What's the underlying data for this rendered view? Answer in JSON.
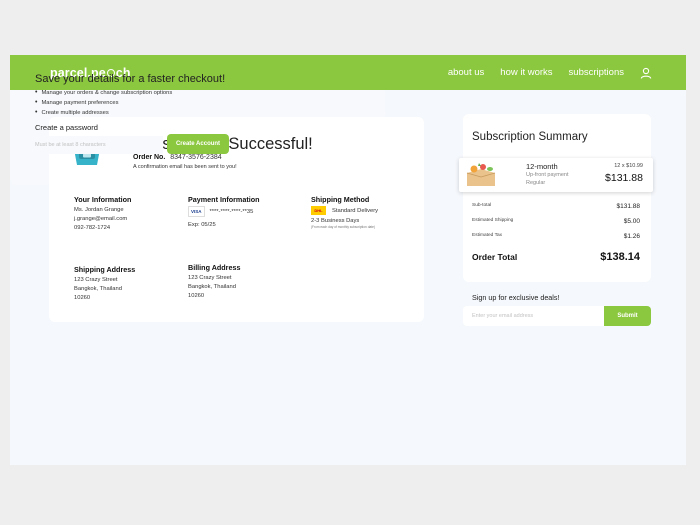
{
  "header": {
    "brand_a": "parcel.pe",
    "brand_b": "ch",
    "nav": [
      "about us",
      "how it works",
      "subscriptions"
    ]
  },
  "confirmation": {
    "title": "Subscription Successful!",
    "order_label": "Order No.",
    "order_number": "8347-3576-2384",
    "email_notice": "A confirmation email has been sent to you!"
  },
  "your_info": {
    "heading": "Your Information",
    "name": "Ms. Jordan Grange",
    "email": "j.grange@email.com",
    "phone": "092-782-1724"
  },
  "payment": {
    "heading": "Payment Information",
    "card_brand": "VISA",
    "card_number": "****-****-****-**35",
    "expiry": "Exp: 05/25"
  },
  "shipping_method": {
    "heading": "Shipping Method",
    "carrier_logo": "DHL",
    "method": "Standard Delivery",
    "eta": "2-3 Business Days",
    "note": "(From each day of monthly subscription date)"
  },
  "shipping_address": {
    "heading": "Shipping Address",
    "line1": "123 Crazy Street",
    "line2": "Bangkok, Thailand",
    "zip": "10260"
  },
  "billing_address": {
    "heading": "Billing Address",
    "line1": "123 Crazy Street",
    "line2": "Bangkok, Thailand",
    "zip": "10260"
  },
  "save": {
    "title": "Save your details for a faster checkout!",
    "bullets": [
      "Manage your orders & change subscription options",
      "Manage payment preferences",
      "Create multiple addresses"
    ],
    "password_label": "Create a password",
    "password_placeholder": "Must be at least 8 characters",
    "button": "Create Account"
  },
  "summary": {
    "title": "Subscription Summary",
    "product_name": "12-month",
    "product_sub1": "Up-front payment",
    "product_sub2": "Regular",
    "qty": "12 x $10.99",
    "price": "$131.88",
    "rows": [
      {
        "label": "Sub-total",
        "value": "$131.88"
      },
      {
        "label": "Estimated Shipping",
        "value": "$5.00"
      },
      {
        "label": "Estimated Tax",
        "value": "$1.26"
      }
    ],
    "total_label": "Order Total",
    "total_value": "$138.14"
  },
  "signup": {
    "label": "Sign up for exclusive deals!",
    "placeholder": "Enter your email address",
    "button": "Submit"
  },
  "colors": {
    "brand": "#8cc83f",
    "page_bg": "#f5f8fc",
    "visa": "#1a3e8f",
    "dhl_yellow": "#ffcc00",
    "dhl_red": "#d40511"
  },
  "icons": [
    "user-icon",
    "basket-icon",
    "visa-logo",
    "dhl-logo",
    "product-box-icon"
  ]
}
